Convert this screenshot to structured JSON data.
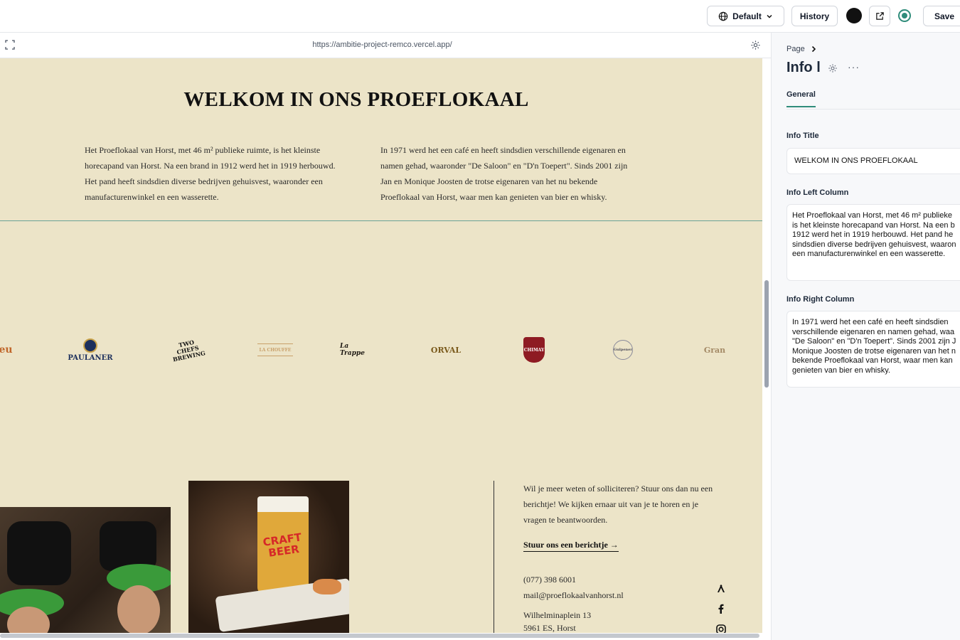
{
  "topbar": {
    "locale_label": "Default",
    "history_label": "History",
    "save_label": "Save"
  },
  "preview": {
    "url": "https://ambitie-project-remco.vercel.app/"
  },
  "page": {
    "title": "WELKOM IN ONS PROEFLOKAAL",
    "left_column": "Het Proeflokaal van Horst, met 46 m² publieke ruimte, is het kleinste horecapand van Horst. Na een brand in 1912 werd het in 1919 herbouwd. Het pand heeft sindsdien diverse bedrijven gehuisvest, waaronder een manufacturenwinkel en een wasserette.",
    "right_column": "In 1971 werd het een café en heeft sindsdien verschillende eigenaren en namen gehad, waaronder \"De Saloon\" en \"D'n Toepert\". Sinds 2001 zijn Jan en Monique Joosten de trotse eigenaren van het nu bekende Proeflokaal van Horst, waar men kan genieten van bier en whisky.",
    "logos": [
      {
        "text": "eu",
        "color": "#c0672b"
      },
      {
        "text": "PAULANER",
        "color": "#1c2f5c"
      },
      {
        "text": "TWO CHEFS BREWING",
        "color": "#111111"
      },
      {
        "text": "LA CHOUFFE",
        "color": "#c9a06a"
      },
      {
        "text": "La Trappe",
        "color": "#1f1a14"
      },
      {
        "text": "ORVAL",
        "color": "#7a5a1c"
      },
      {
        "text": "CHIMAY",
        "color": "#8e1b23"
      },
      {
        "text": "Gulpener",
        "color": "#4a4a5a"
      },
      {
        "text": "Gran",
        "color": "#a48a66"
      }
    ],
    "contact": {
      "text": "Wil je meer weten of solliciteren? Stuur ons dan nu een berichtje! We kijken ernaar uit van je te horen en je vragen te beantwoorden.",
      "link_label": "Stuur ons een berichtje →",
      "phone": "(077) 398 6001",
      "email": "mail@proeflokaalvanhorst.nl",
      "street": "Wilhelminaplein 13",
      "city": "5961 ES, Horst"
    },
    "image_2_text": "CRAFT BEER"
  },
  "panel": {
    "breadcrumb": "Page",
    "title": "Info l",
    "tab_general": "General",
    "info_title_label": "Info Title",
    "info_title_value": "WELKOM IN ONS PROEFLOKAAL",
    "info_left_label": "Info Left Column",
    "info_left_value": "Het Proeflokaal van Horst, met 46 m² publieke\nis het kleinste horecapand van Horst. Na een b\n1912 werd het in 1919 herbouwd. Het pand he\nsindsdien diverse bedrijven gehuisvest, waaron\neen manufacturenwinkel en een wasserette.",
    "info_right_label": "Info Right Column",
    "info_right_value": "In 1971 werd het een café en heeft sindsdien\nverschillende eigenaren en namen gehad, waa\n\"De Saloon\" en \"D'n Toepert\". Sinds 2001 zijn J\nMonique Joosten de trotse eigenaren van het n\nbekende Proeflokaal van Horst, waar men kan\ngenieten van bier en whisky."
  },
  "icons": {
    "globe": "globe-icon",
    "chevron": "chevron-down-icon",
    "external": "external-link-icon",
    "status": "status-icon",
    "expand": "expand-icon",
    "gear": "gear-icon",
    "more": "more-icon",
    "arrow": "arrow-right-icon",
    "untappd": "untappd-icon",
    "facebook": "facebook-icon",
    "instagram": "instagram-icon"
  },
  "colors": {
    "accent": "#2f8c7a",
    "canvas_bg": "#ece4c8",
    "panel_bg": "#f7f8fa"
  }
}
